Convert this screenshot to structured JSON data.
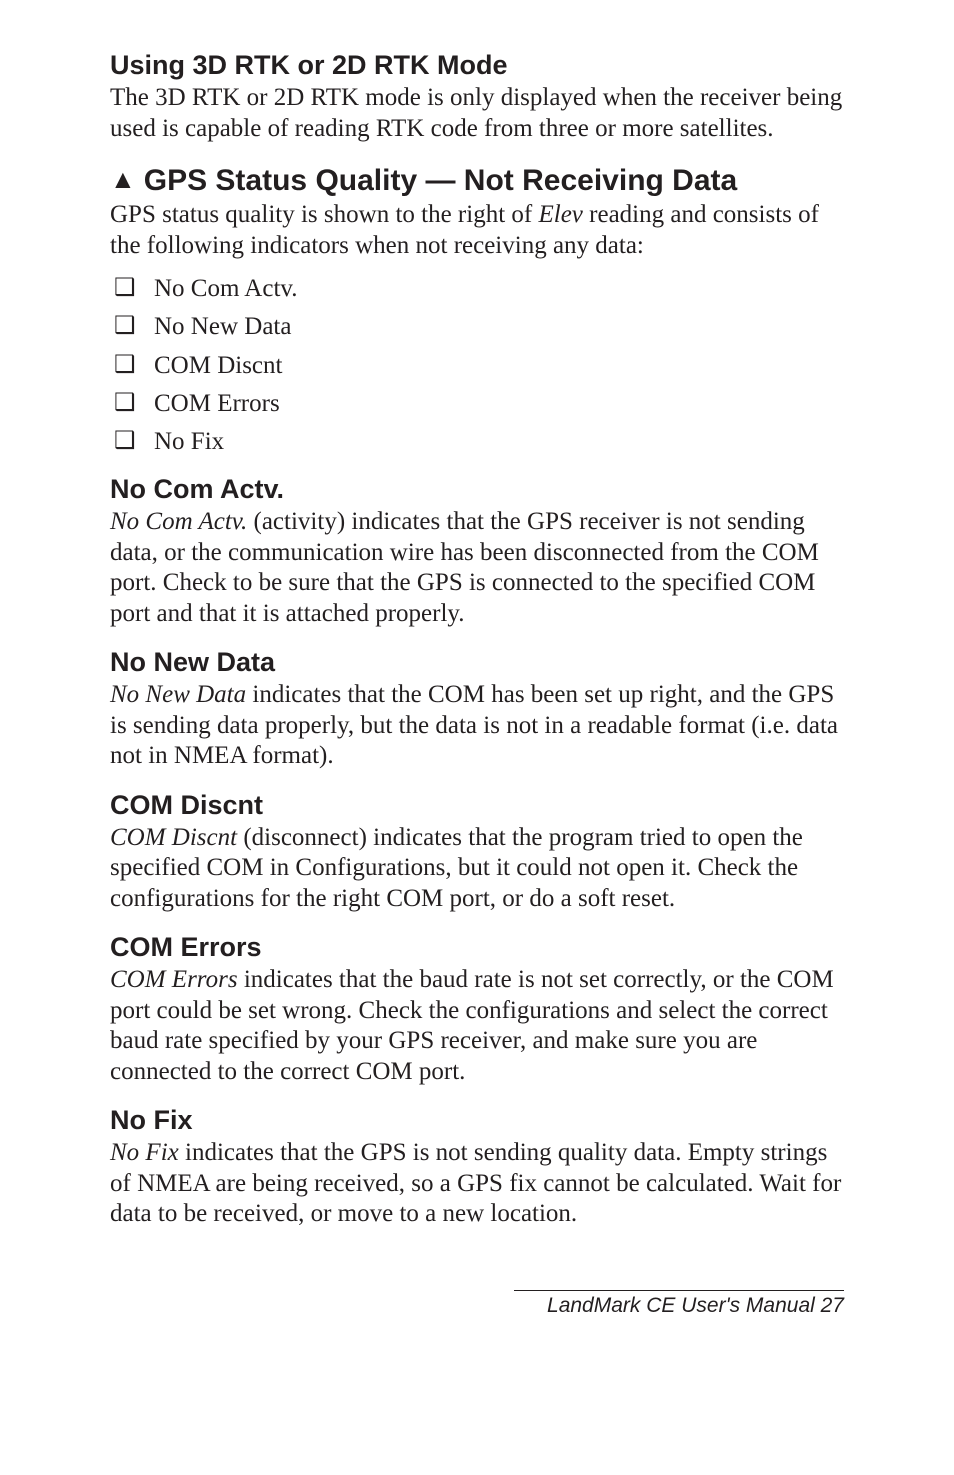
{
  "sections": {
    "rtk": {
      "heading": "Using 3D RTK or 2D RTK Mode",
      "body": "The 3D RTK or 2D RTK mode is only displayed when the receiver being used is capable of reading RTK code from three or more satellites."
    },
    "status": {
      "heading": "GPS Status Quality — Not Receiving Data",
      "intro_pre": "GPS status quality is shown to the right of ",
      "intro_em": "Elev",
      "intro_post": " reading and consists of the following indicators when not receiving any data:",
      "items": [
        "No Com Actv.",
        "No New Data",
        "COM Discnt",
        "COM Errors",
        "No Fix"
      ]
    },
    "noComActv": {
      "heading": "No Com Actv.",
      "em": "No Com Actv.",
      "body": " (activity) indicates that the GPS receiver is not sending data, or the communication wire has been disconnected from the COM port. Check to be sure that the GPS is connected to the specified COM port and that it is attached properly."
    },
    "noNewData": {
      "heading": "No New Data",
      "em": "No New Data",
      "body": " indicates that the COM has been set up right, and the GPS is sending data properly, but the data is not in a readable format (i.e. data not in NMEA format)."
    },
    "comDiscnt": {
      "heading": "COM Discnt",
      "em": "COM Discnt",
      "body": " (disconnect) indicates that the program tried to open the specified COM in Configurations, but it could not open it. Check the configurations for the right COM port, or do a soft reset."
    },
    "comErrors": {
      "heading": "COM Errors",
      "em": "COM Errors",
      "body": " indicates that the baud rate is not set  correctly, or the COM port could be set wrong. Check the configurations and select the correct baud rate specified by your GPS receiver, and make sure you are connected to the correct COM port."
    },
    "noFix": {
      "heading": "No Fix",
      "em": "No Fix",
      "body": " indicates that the GPS is not sending quality data. Empty strings of NMEA are being received, so a GPS fix cannot be calculated. Wait for data to be received, or move to a new location."
    }
  },
  "footer": "LandMark CE User's Manual  27"
}
